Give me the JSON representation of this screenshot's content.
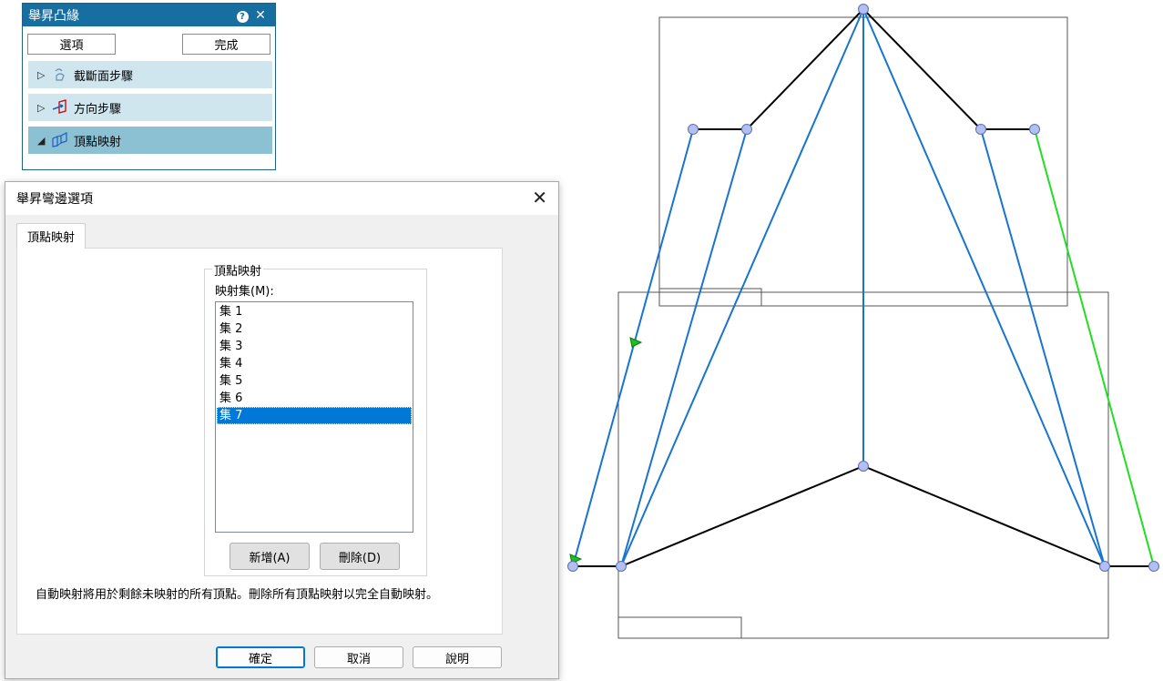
{
  "panel": {
    "title": "舉昇凸緣",
    "help_label": "?",
    "close_label": "✕",
    "options_button": "選項",
    "done_button": "完成",
    "steps": [
      {
        "label": "截斷面步驟",
        "icon": "section-step-icon",
        "expanded": false
      },
      {
        "label": "方向步驟",
        "icon": "direction-step-icon",
        "expanded": false
      },
      {
        "label": "頂點映射",
        "icon": "vertex-mapping-icon",
        "expanded": true
      }
    ]
  },
  "dialog": {
    "title": "舉昇彎邊選項",
    "close_label": "✕",
    "tab_label": "頂點映射",
    "group_title": "頂點映射",
    "list_label": "映射集(M):",
    "sets": [
      "集 1",
      "集 2",
      "集 3",
      "集 4",
      "集 5",
      "集 6",
      "集 7"
    ],
    "selected_set": "集 7",
    "add_button": "新增(A)",
    "delete_button": "刪除(D)",
    "note": "自動映射將用於剩餘未映射的所有頂點。刪除所有頂點映射以完全自動映射。",
    "ok_button": "確定",
    "cancel_button": "取消",
    "help_button": "說明"
  },
  "colors": {
    "panel_title_bg": "#176ea1",
    "step_bg": "#cfe6ef",
    "step_active_bg": "#8cc1d4",
    "selection": "#0078d7",
    "profile_line": "#000000",
    "mapping_line": "#1874cd",
    "selected_mapping_line": "#22dd22",
    "vertex_fill": "#b3bff0"
  }
}
